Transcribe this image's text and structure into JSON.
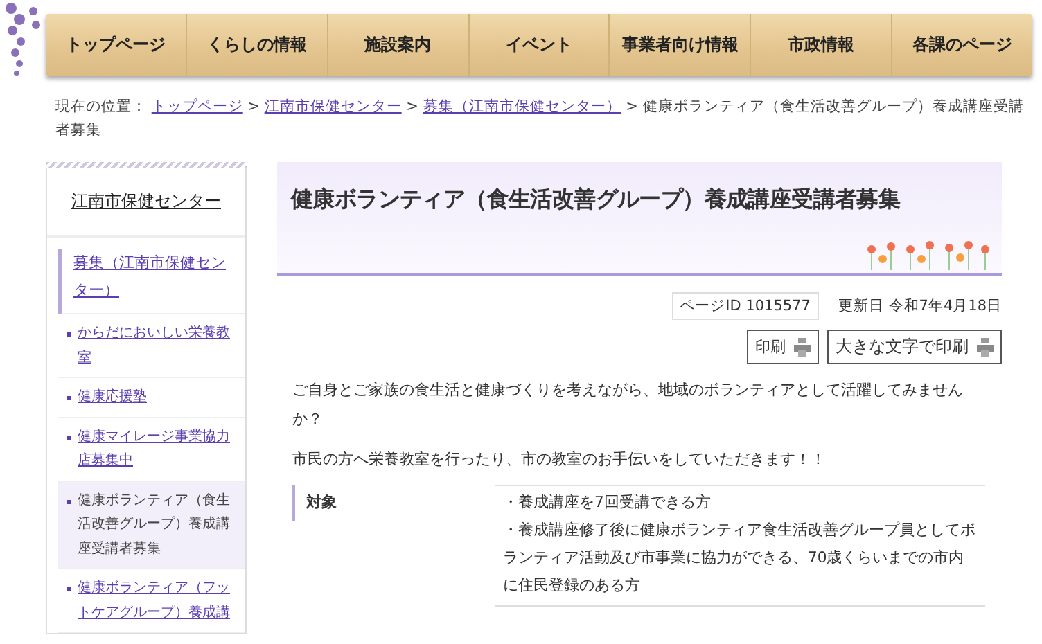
{
  "nav": [
    {
      "label": "トップページ"
    },
    {
      "label": "くらしの情報"
    },
    {
      "label": "施設案内"
    },
    {
      "label": "イベント"
    },
    {
      "label": "事業者向け情報"
    },
    {
      "label": "市政情報"
    },
    {
      "label": "各課のページ"
    }
  ],
  "breadcrumb": {
    "label": "現在の位置：",
    "separator": ">",
    "links": [
      "トップページ",
      "江南市保健センター",
      "募集（江南市保健センター）"
    ],
    "current": "健康ボランティア（食生活改善グループ）養成講座受講者募集"
  },
  "sidebar": {
    "heading": "江南市保健センター",
    "section": "募集（江南市保健センター）",
    "items": [
      {
        "label": "からだにおいしい栄養教室",
        "selected": false
      },
      {
        "label": "健康応援塾",
        "selected": false
      },
      {
        "label": "健康マイレージ事業協力店募集中",
        "selected": false
      },
      {
        "label": "健康ボランティア（食生活改善グループ）養成講座受講者募集",
        "selected": true
      },
      {
        "label": "健康ボランティア（フットケアグループ）養成講",
        "selected": false
      }
    ]
  },
  "page": {
    "title": "健康ボランティア（食生活改善グループ）養成講座受講者募集",
    "page_id": "ページID 1015577",
    "updated": "更新日 令和7年4月18日",
    "print_buttons": [
      "印刷",
      "大きな文字で印刷"
    ],
    "paragraphs": [
      "ご自身とご家族の食生活と健康づくりを考えながら、地域のボランティアとして活躍してみませんか？",
      "市民の方へ栄養教室を行ったり、市の教室のお手伝いをしていただきます！！"
    ],
    "table": [
      {
        "label": "対象",
        "lines": [
          "・養成講座を7回受講できる方",
          "・養成講座修了後に健康ボランティア食生活改善グループ員としてボランティア活動及び市事業に協力ができる、70歳くらいまでの市内に住民登録のある方"
        ]
      }
    ]
  }
}
